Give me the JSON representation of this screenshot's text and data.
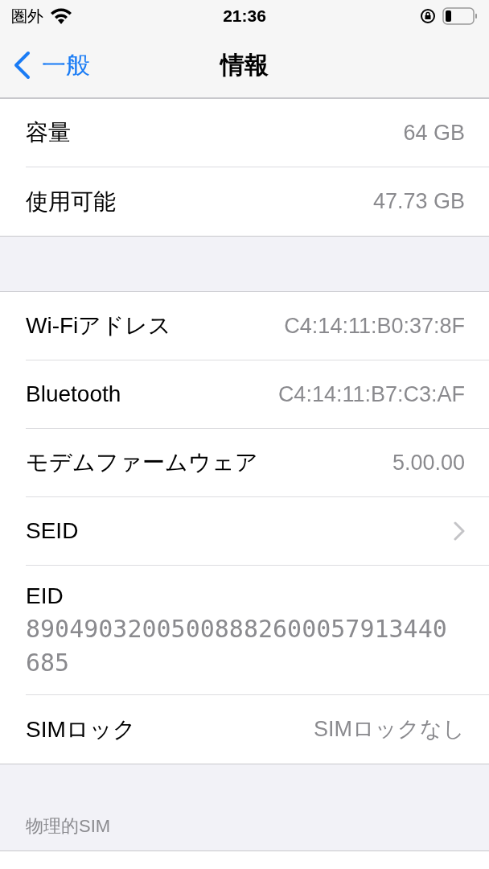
{
  "status_bar": {
    "carrier": "圏外",
    "time": "21:36"
  },
  "nav": {
    "back": "一般",
    "title": "情報"
  },
  "groups": [
    {
      "rows": [
        {
          "kind": "value",
          "label": "容量",
          "value": "64 GB"
        },
        {
          "kind": "value",
          "label": "使用可能",
          "value": "47.73 GB"
        }
      ]
    },
    {
      "rows": [
        {
          "kind": "value",
          "label": "Wi-Fiアドレス",
          "value": "C4:14:11:B0:37:8F"
        },
        {
          "kind": "value",
          "label": "Bluetooth",
          "value": "C4:14:11:B7:C3:AF"
        },
        {
          "kind": "value",
          "label": "モデムファームウェア",
          "value": "5.00.00"
        },
        {
          "kind": "disclosure",
          "label": "SEID"
        },
        {
          "kind": "stacked",
          "label": "EID",
          "value": "89049032005008882600057913440685"
        },
        {
          "kind": "value",
          "label": "SIMロック",
          "value": "SIMロックなし"
        }
      ]
    },
    {
      "header": "物理的SIM"
    }
  ]
}
